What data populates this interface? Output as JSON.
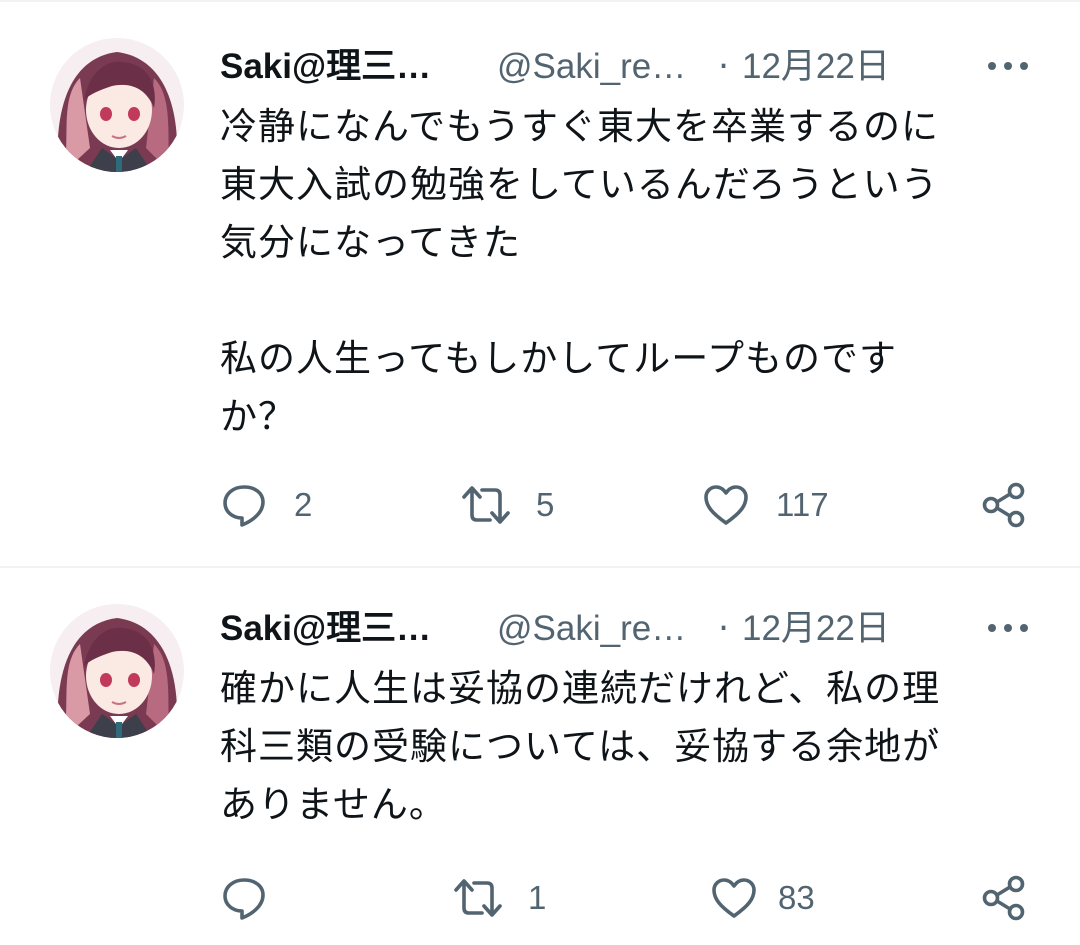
{
  "tweets": [
    {
      "display_name": "Saki@理三…",
      "handle": "@Saki_re…",
      "separator": "·",
      "date": "12月22日",
      "text": "冷静になんでもうすぐ東大を卒業するのに\n東大入試の勉強をしているんだろうという\n気分になってきた\n\n私の人生ってもしかしてループものです\nか？",
      "replies": "2",
      "retweets": "5",
      "likes": "117"
    },
    {
      "display_name": "Saki@理三…",
      "handle": "@Saki_re…",
      "separator": "·",
      "date": "12月22日",
      "text": "確かに人生は妥協の連続だけれど、私の理\n科三類の受験については、妥協する余地が\nありません。",
      "replies": "",
      "retweets": "1",
      "likes": "83"
    }
  ],
  "icons": {
    "reply": "reply-icon",
    "retweet": "retweet-icon",
    "like": "heart-icon",
    "share": "share-icon",
    "more": "more-dots-icon"
  },
  "colors": {
    "text": "#0f1419",
    "secondary": "#536471",
    "divider": "#eff3f4"
  }
}
